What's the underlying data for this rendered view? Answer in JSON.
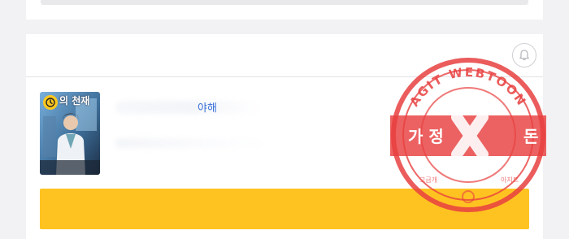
{
  "thumbnail": {
    "title_text": "의 천재"
  },
  "content": {
    "partial_text": "야해"
  },
  "watermark": {
    "ring_text": "AGIT WEBTOON",
    "banner_left": "가 정",
    "banner_right": "돈",
    "bottom_left": "고급개",
    "bottom_right": "아지트"
  },
  "colors": {
    "accent_yellow": "#ffc321",
    "link_blue": "#3a6fd8",
    "watermark_red": "#e23b3b"
  },
  "icons": {
    "notification": "bell-icon",
    "badge": "clock-icon"
  }
}
